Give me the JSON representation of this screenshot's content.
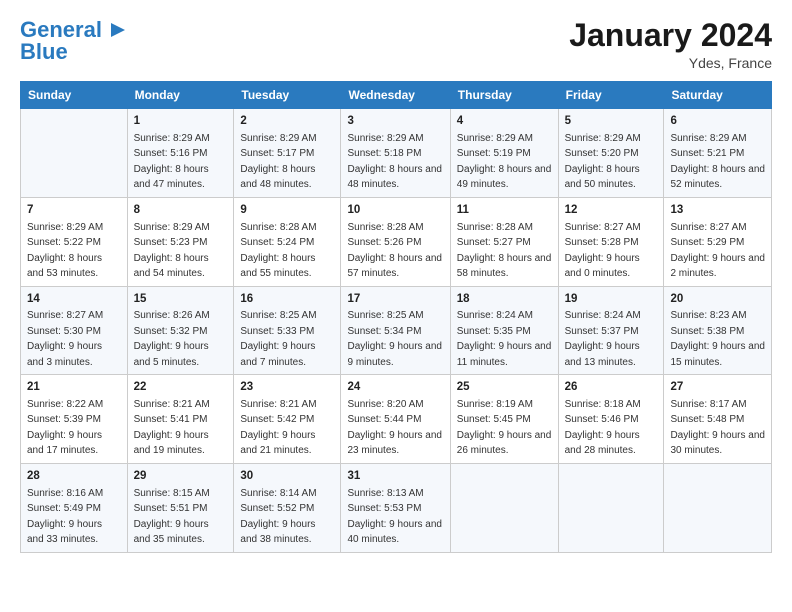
{
  "header": {
    "logo_line1": "General",
    "logo_line2": "Blue",
    "month_title": "January 2024",
    "location": "Ydes, France"
  },
  "days_of_week": [
    "Sunday",
    "Monday",
    "Tuesday",
    "Wednesday",
    "Thursday",
    "Friday",
    "Saturday"
  ],
  "weeks": [
    [
      {
        "day": "",
        "sunrise": "",
        "sunset": "",
        "daylight": ""
      },
      {
        "day": "1",
        "sunrise": "Sunrise: 8:29 AM",
        "sunset": "Sunset: 5:16 PM",
        "daylight": "Daylight: 8 hours and 47 minutes."
      },
      {
        "day": "2",
        "sunrise": "Sunrise: 8:29 AM",
        "sunset": "Sunset: 5:17 PM",
        "daylight": "Daylight: 8 hours and 48 minutes."
      },
      {
        "day": "3",
        "sunrise": "Sunrise: 8:29 AM",
        "sunset": "Sunset: 5:18 PM",
        "daylight": "Daylight: 8 hours and 48 minutes."
      },
      {
        "day": "4",
        "sunrise": "Sunrise: 8:29 AM",
        "sunset": "Sunset: 5:19 PM",
        "daylight": "Daylight: 8 hours and 49 minutes."
      },
      {
        "day": "5",
        "sunrise": "Sunrise: 8:29 AM",
        "sunset": "Sunset: 5:20 PM",
        "daylight": "Daylight: 8 hours and 50 minutes."
      },
      {
        "day": "6",
        "sunrise": "Sunrise: 8:29 AM",
        "sunset": "Sunset: 5:21 PM",
        "daylight": "Daylight: 8 hours and 52 minutes."
      }
    ],
    [
      {
        "day": "7",
        "sunrise": "Sunrise: 8:29 AM",
        "sunset": "Sunset: 5:22 PM",
        "daylight": "Daylight: 8 hours and 53 minutes."
      },
      {
        "day": "8",
        "sunrise": "Sunrise: 8:29 AM",
        "sunset": "Sunset: 5:23 PM",
        "daylight": "Daylight: 8 hours and 54 minutes."
      },
      {
        "day": "9",
        "sunrise": "Sunrise: 8:28 AM",
        "sunset": "Sunset: 5:24 PM",
        "daylight": "Daylight: 8 hours and 55 minutes."
      },
      {
        "day": "10",
        "sunrise": "Sunrise: 8:28 AM",
        "sunset": "Sunset: 5:26 PM",
        "daylight": "Daylight: 8 hours and 57 minutes."
      },
      {
        "day": "11",
        "sunrise": "Sunrise: 8:28 AM",
        "sunset": "Sunset: 5:27 PM",
        "daylight": "Daylight: 8 hours and 58 minutes."
      },
      {
        "day": "12",
        "sunrise": "Sunrise: 8:27 AM",
        "sunset": "Sunset: 5:28 PM",
        "daylight": "Daylight: 9 hours and 0 minutes."
      },
      {
        "day": "13",
        "sunrise": "Sunrise: 8:27 AM",
        "sunset": "Sunset: 5:29 PM",
        "daylight": "Daylight: 9 hours and 2 minutes."
      }
    ],
    [
      {
        "day": "14",
        "sunrise": "Sunrise: 8:27 AM",
        "sunset": "Sunset: 5:30 PM",
        "daylight": "Daylight: 9 hours and 3 minutes."
      },
      {
        "day": "15",
        "sunrise": "Sunrise: 8:26 AM",
        "sunset": "Sunset: 5:32 PM",
        "daylight": "Daylight: 9 hours and 5 minutes."
      },
      {
        "day": "16",
        "sunrise": "Sunrise: 8:25 AM",
        "sunset": "Sunset: 5:33 PM",
        "daylight": "Daylight: 9 hours and 7 minutes."
      },
      {
        "day": "17",
        "sunrise": "Sunrise: 8:25 AM",
        "sunset": "Sunset: 5:34 PM",
        "daylight": "Daylight: 9 hours and 9 minutes."
      },
      {
        "day": "18",
        "sunrise": "Sunrise: 8:24 AM",
        "sunset": "Sunset: 5:35 PM",
        "daylight": "Daylight: 9 hours and 11 minutes."
      },
      {
        "day": "19",
        "sunrise": "Sunrise: 8:24 AM",
        "sunset": "Sunset: 5:37 PM",
        "daylight": "Daylight: 9 hours and 13 minutes."
      },
      {
        "day": "20",
        "sunrise": "Sunrise: 8:23 AM",
        "sunset": "Sunset: 5:38 PM",
        "daylight": "Daylight: 9 hours and 15 minutes."
      }
    ],
    [
      {
        "day": "21",
        "sunrise": "Sunrise: 8:22 AM",
        "sunset": "Sunset: 5:39 PM",
        "daylight": "Daylight: 9 hours and 17 minutes."
      },
      {
        "day": "22",
        "sunrise": "Sunrise: 8:21 AM",
        "sunset": "Sunset: 5:41 PM",
        "daylight": "Daylight: 9 hours and 19 minutes."
      },
      {
        "day": "23",
        "sunrise": "Sunrise: 8:21 AM",
        "sunset": "Sunset: 5:42 PM",
        "daylight": "Daylight: 9 hours and 21 minutes."
      },
      {
        "day": "24",
        "sunrise": "Sunrise: 8:20 AM",
        "sunset": "Sunset: 5:44 PM",
        "daylight": "Daylight: 9 hours and 23 minutes."
      },
      {
        "day": "25",
        "sunrise": "Sunrise: 8:19 AM",
        "sunset": "Sunset: 5:45 PM",
        "daylight": "Daylight: 9 hours and 26 minutes."
      },
      {
        "day": "26",
        "sunrise": "Sunrise: 8:18 AM",
        "sunset": "Sunset: 5:46 PM",
        "daylight": "Daylight: 9 hours and 28 minutes."
      },
      {
        "day": "27",
        "sunrise": "Sunrise: 8:17 AM",
        "sunset": "Sunset: 5:48 PM",
        "daylight": "Daylight: 9 hours and 30 minutes."
      }
    ],
    [
      {
        "day": "28",
        "sunrise": "Sunrise: 8:16 AM",
        "sunset": "Sunset: 5:49 PM",
        "daylight": "Daylight: 9 hours and 33 minutes."
      },
      {
        "day": "29",
        "sunrise": "Sunrise: 8:15 AM",
        "sunset": "Sunset: 5:51 PM",
        "daylight": "Daylight: 9 hours and 35 minutes."
      },
      {
        "day": "30",
        "sunrise": "Sunrise: 8:14 AM",
        "sunset": "Sunset: 5:52 PM",
        "daylight": "Daylight: 9 hours and 38 minutes."
      },
      {
        "day": "31",
        "sunrise": "Sunrise: 8:13 AM",
        "sunset": "Sunset: 5:53 PM",
        "daylight": "Daylight: 9 hours and 40 minutes."
      },
      {
        "day": "",
        "sunrise": "",
        "sunset": "",
        "daylight": ""
      },
      {
        "day": "",
        "sunrise": "",
        "sunset": "",
        "daylight": ""
      },
      {
        "day": "",
        "sunrise": "",
        "sunset": "",
        "daylight": ""
      }
    ]
  ]
}
